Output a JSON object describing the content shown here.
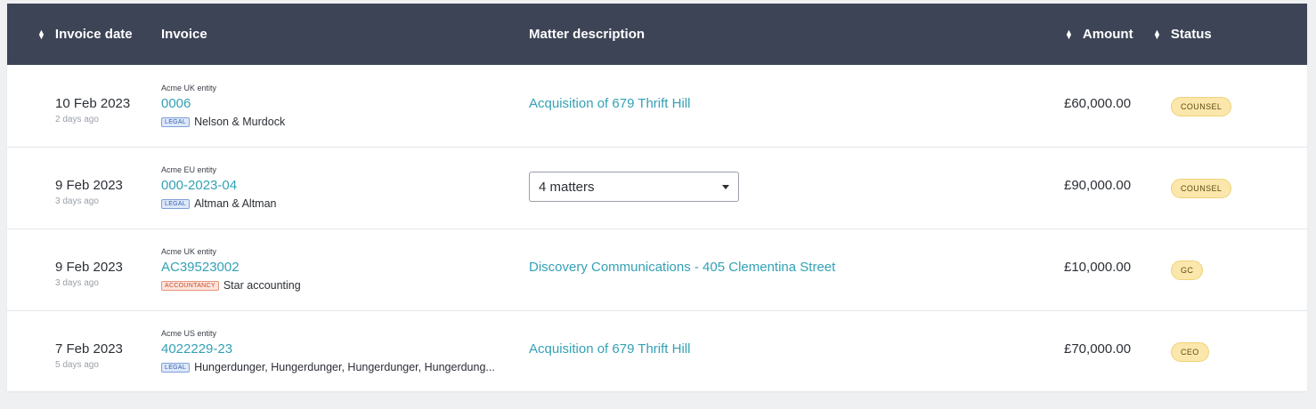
{
  "columns": {
    "invoice_date": "Invoice date",
    "invoice": "Invoice",
    "matter": "Matter description",
    "amount": "Amount",
    "status": "Status"
  },
  "rows": [
    {
      "date": "10 Feb 2023",
      "ago": "2 days ago",
      "entity": "Acme UK entity",
      "invoice": "0006",
      "tag": "LEGAL",
      "firm": "Nelson & Murdock",
      "matter": "Acquisition of 679 Thrift Hill",
      "amount": "£60,000.00",
      "status": "COUNSEL"
    },
    {
      "date": "9 Feb 2023",
      "ago": "3 days ago",
      "entity": "Acme EU entity",
      "invoice": "000-2023-04",
      "tag": "LEGAL",
      "firm": "Altman & Altman",
      "matter_select": "4 matters",
      "amount": "£90,000.00",
      "status": "COUNSEL"
    },
    {
      "date": "9 Feb 2023",
      "ago": "3 days ago",
      "entity": "Acme UK entity",
      "invoice": "AC39523002",
      "tag": "ACCOUNTANCY",
      "firm": "Star accounting",
      "matter": "Discovery Communications - 405 Clementina Street",
      "amount": "£10,000.00",
      "status": "GC"
    },
    {
      "date": "7 Feb 2023",
      "ago": "5 days ago",
      "entity": "Acme US entity",
      "invoice": "4022229-23",
      "tag": "LEGAL",
      "firm": "Hungerdunger, Hungerdunger, Hungerdunger, Hungerdung...",
      "matter": "Acquisition of 679 Thrift Hill",
      "amount": "£70,000.00",
      "status": "CEO"
    }
  ],
  "colors": {
    "header_bg": "#3d4456",
    "link": "#33a1b5",
    "badge_bg": "#fbe7ab",
    "legal_tag": "#dde8fb",
    "accountancy_tag": "#fde3db"
  }
}
